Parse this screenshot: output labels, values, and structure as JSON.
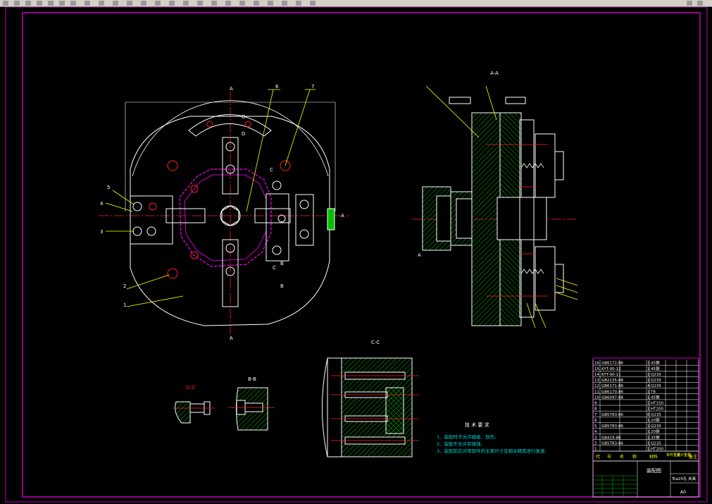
{
  "views": {
    "section_aa": "A-A",
    "section_cc": "C-C",
    "section_dd": "D-D",
    "section_bb": "B-B"
  },
  "markers": {
    "A": "A",
    "B": "B",
    "C": "C",
    "D": "D"
  },
  "part_callouts": [
    "1",
    "2",
    "3",
    "4",
    "5",
    "6",
    "7"
  ],
  "tech_requirements": {
    "title": "技 术 要 求",
    "items": [
      "1、装配时不允许磕碰、划伤;",
      "2、装配不允许有锈蚀;",
      "3、装配前应对零部件的主要尺寸及相关精度进行复查;"
    ]
  },
  "bom": {
    "rows": [
      {
        "no": "16",
        "code": "GB6172-86",
        "name": "",
        "qty": "1",
        "material": "45钢"
      },
      {
        "no": "15",
        "code": "KYT-00-12",
        "name": "",
        "qty": "1",
        "material": "45钢"
      },
      {
        "no": "14",
        "code": "KYT-00-11",
        "name": "",
        "qty": "1",
        "material": "Q235"
      },
      {
        "no": "13",
        "code": "GB2135-88",
        "name": "",
        "qty": "1",
        "material": "Q235"
      },
      {
        "no": "12",
        "code": "GB6171-86",
        "name": "",
        "qty": "4",
        "material": "Q235"
      },
      {
        "no": "11",
        "code": "GB6170-86",
        "name": "",
        "qty": "1",
        "material": "T8"
      },
      {
        "no": "10",
        "code": "GB6097-88",
        "name": "",
        "qty": "1",
        "material": "45钢"
      },
      {
        "no": "9",
        "code": "",
        "name": "",
        "qty": "1",
        "material": "HT150"
      },
      {
        "no": "8",
        "code": "",
        "name": "",
        "qty": "1",
        "material": "HT200"
      },
      {
        "no": "7",
        "code": "GB5783-86",
        "name": "",
        "qty": "6",
        "material": "Q235"
      },
      {
        "no": "6",
        "code": "",
        "name": "",
        "qty": "1",
        "material": "20钢"
      },
      {
        "no": "5",
        "code": "GB5783-86",
        "name": "",
        "qty": "1",
        "material": "Q235"
      },
      {
        "no": "4",
        "code": "",
        "name": "",
        "qty": "1",
        "material": "20钢"
      },
      {
        "no": "3",
        "code": "GB419-86",
        "name": "",
        "qty": "1",
        "material": "35钢"
      },
      {
        "no": "2",
        "code": "GB5783-86",
        "name": "",
        "qty": "1",
        "material": "Q235"
      },
      {
        "no": "1",
        "code": "",
        "name": "",
        "qty": "1",
        "material": "HT200"
      }
    ],
    "header": [
      "代",
      "号",
      "名",
      "称",
      "材料",
      "单件重量",
      "总计重量",
      "备注"
    ],
    "title_block_name": "装配图",
    "title_block_part": "车ø25孔 夹具",
    "scale": "A0"
  },
  "colors": {
    "background": "#000000",
    "border": "#c000c0",
    "part": "#ffffff",
    "centerline": "#ff2020",
    "hatch": "#00c000",
    "leader": "#ffff00",
    "dimension": "#00d0d0",
    "magenta": "#ff00ff"
  }
}
